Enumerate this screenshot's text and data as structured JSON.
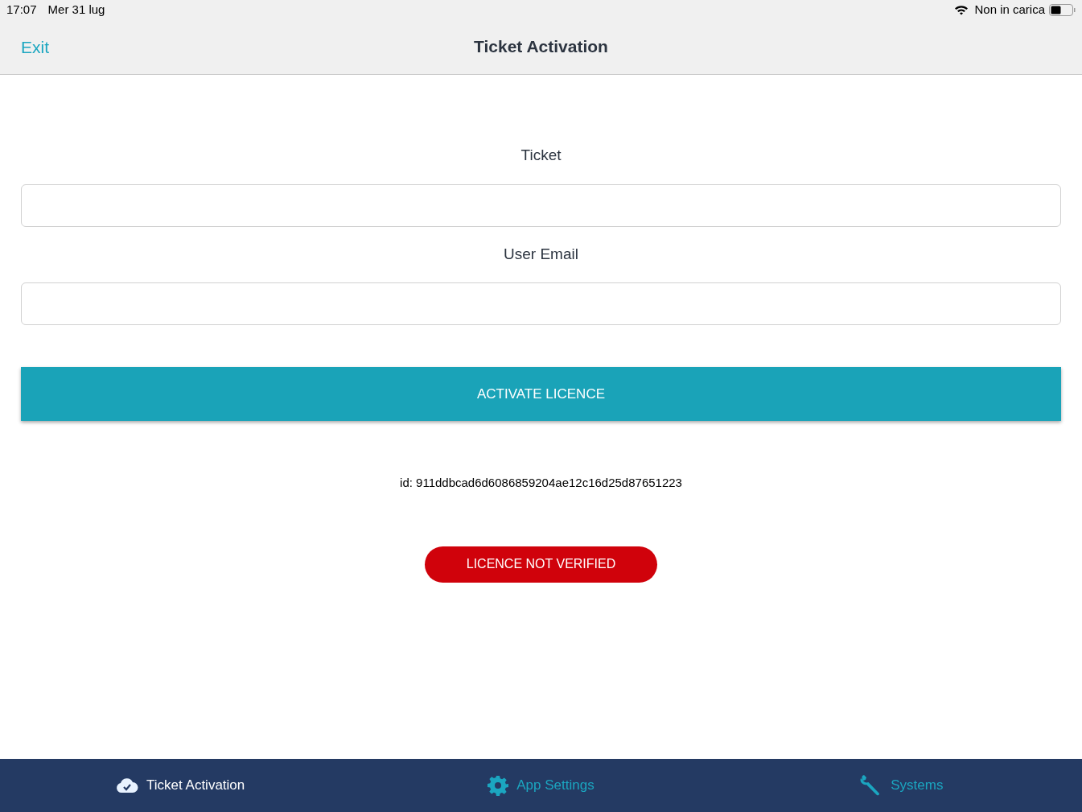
{
  "status_bar": {
    "time": "17:07",
    "date": "Mer 31 lug",
    "charging": "Non in carica"
  },
  "nav": {
    "back": "Exit",
    "title": "Ticket Activation"
  },
  "form": {
    "fields": [
      {
        "label": "Ticket"
      },
      {
        "label": "User Email"
      }
    ],
    "button": "ACTIVATE LICENCE",
    "id_text": "id: 911ddbcad6d6086859204ae12c16d25d87651223",
    "status": "LICENCE NOT VERIFIED"
  },
  "tabs": [
    {
      "label": "Ticket Activation",
      "kind": "cloud",
      "selected": true
    },
    {
      "label": "App Settings",
      "kind": "gear",
      "selected": false
    },
    {
      "label": "Systems",
      "kind": "wrench",
      "selected": false
    }
  ]
}
